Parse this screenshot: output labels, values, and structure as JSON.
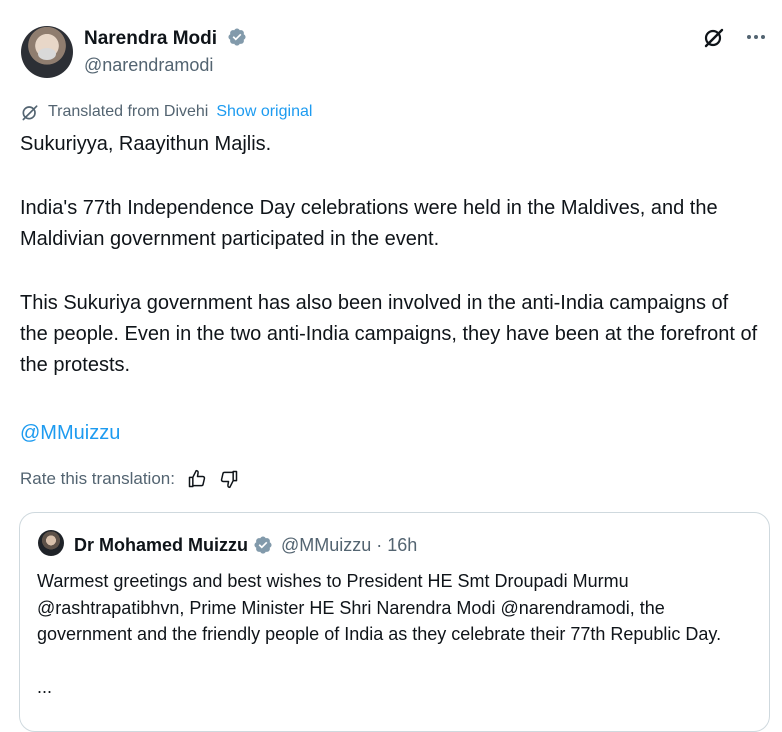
{
  "author": {
    "name": "Narendra Modi",
    "handle": "@narendramodi"
  },
  "translation": {
    "note": "Translated from Divehi",
    "show_original": "Show original"
  },
  "tweet": {
    "paragraphs": [
      "Sukuriyya, Raayithun Majlis.",
      "India's 77th Independence Day celebrations were held in the Maldives, and the Maldivian government participated in the event.",
      "This Sukuriya government has also been involved in the anti-India campaigns of the people. Even in the two anti-India campaigns, they have been at the forefront of the protests."
    ],
    "mention": "@MMuizzu"
  },
  "rate": {
    "label": "Rate this translation:"
  },
  "quote": {
    "name": "Dr Mohamed Muizzu",
    "handle": "@MMuizzu",
    "separator": "·",
    "time": "16h",
    "text": "Warmest greetings and best wishes to President HE Smt Droupadi Murmu @rashtrapatibhvn, Prime Minister HE Shri Narendra Modi @narendramodi, the government and the friendly people of India as they celebrate their 77th Republic Day.",
    "ellipsis": "..."
  },
  "colors": {
    "accent": "#1d9bf0",
    "muted": "#536471",
    "text": "#0f1419",
    "border": "#cfd9de"
  },
  "icons": [
    "verified-badge-icon",
    "grok-icon",
    "more-icon",
    "translate-icon",
    "thumbs-up-icon",
    "thumbs-down-icon"
  ]
}
